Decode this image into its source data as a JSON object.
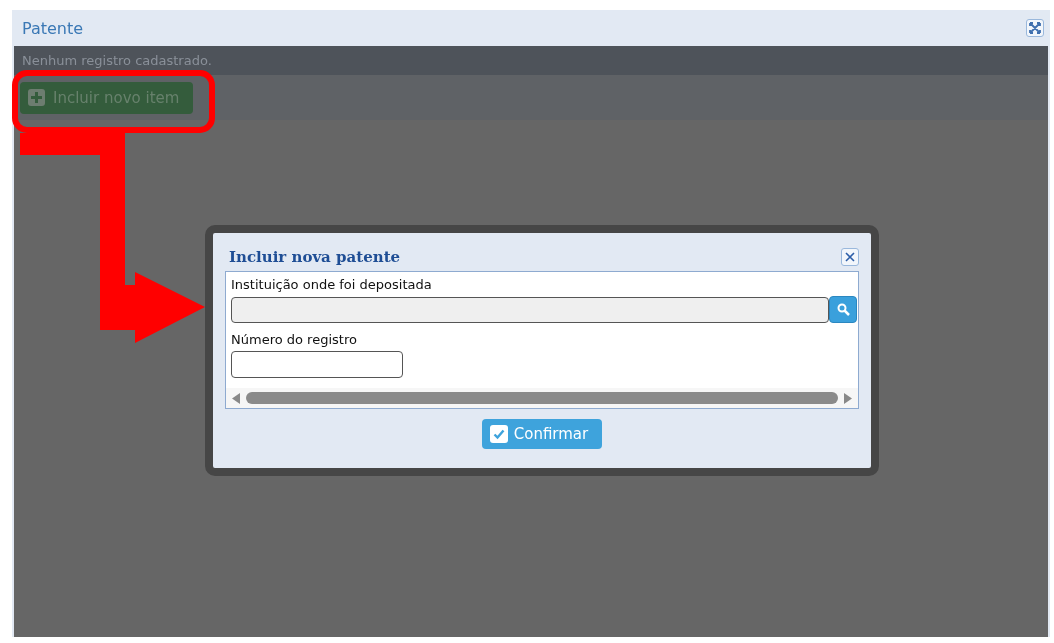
{
  "panel": {
    "title": "Patente",
    "empty_message": "Nenhum registro cadastrado.",
    "add_button": "Incluir novo item"
  },
  "dialog": {
    "title": "Incluir nova patente",
    "fields": [
      {
        "label": "Instituição onde foi depositada",
        "kind": "lookup"
      },
      {
        "label": "Número do registro",
        "kind": "text"
      }
    ],
    "confirm_button": "Confirmar"
  }
}
